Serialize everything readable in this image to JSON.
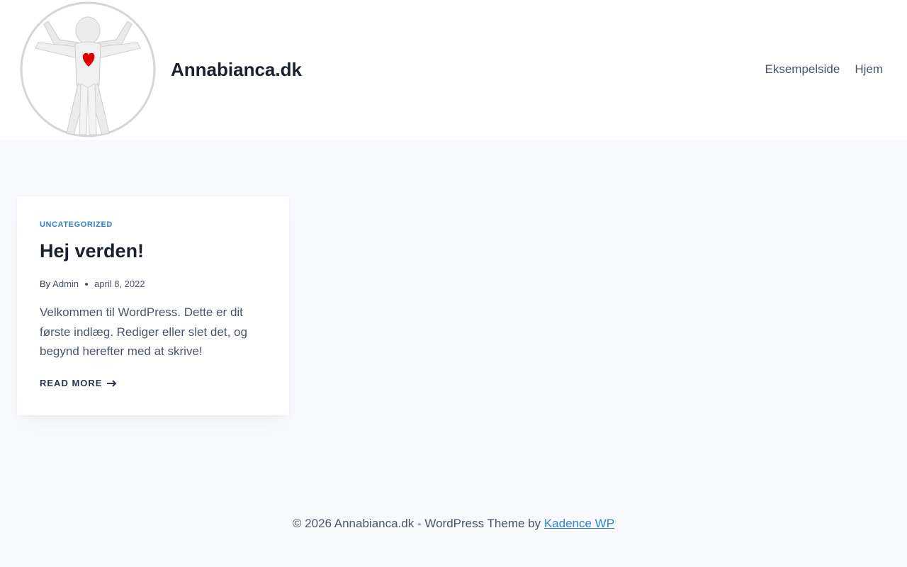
{
  "header": {
    "site_title": "Annabianca.dk",
    "logo_icon": "person-with-heart-logo",
    "nav": [
      {
        "label": "Eksempelside"
      },
      {
        "label": "Hjem"
      }
    ]
  },
  "post": {
    "category": "UNCATEGORIZED",
    "title": "Hej verden!",
    "by": "By",
    "author": "Admin",
    "date": "april 8, 2022",
    "excerpt": "Velkommen til WordPress. Dette er dit første indlæg. Rediger eller slet det, og begynd herefter med at skrive!",
    "read_more": "READ MORE"
  },
  "footer": {
    "text": "© 2026 Annabianca.dk - WordPress Theme by ",
    "link": "Kadence WP"
  },
  "colors": {
    "accent": "#3182ce",
    "heart": "#e00000",
    "background": "#f7f9fc"
  }
}
